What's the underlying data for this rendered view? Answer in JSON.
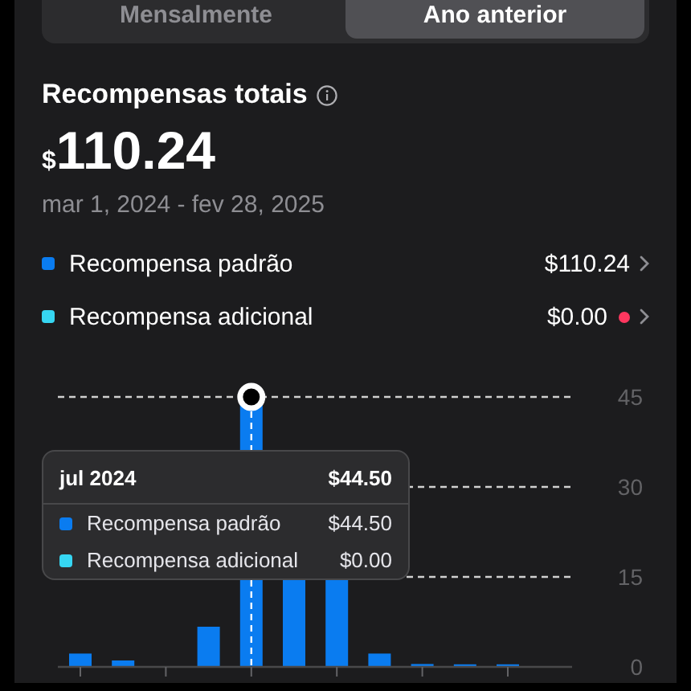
{
  "segments": [
    {
      "label": "Mensalmente",
      "selected": false
    },
    {
      "label": "Ano anterior",
      "selected": true
    }
  ],
  "summary": {
    "title": "Recompensas totais",
    "currency": "$",
    "amount": "110.24",
    "period": "mar 1, 2024 - fev 28, 2025"
  },
  "breakdown": [
    {
      "label": "Recompensa padrão",
      "value": "$110.24",
      "color": "#0a7cf0",
      "alert": false
    },
    {
      "label": "Recompensa adicional",
      "value": "$0.00",
      "color": "#36d6f2",
      "alert": true
    }
  ],
  "chart": {
    "y_labels": [
      "45",
      "30",
      "15",
      "0"
    ],
    "tooltip": {
      "period": "jul 2024",
      "total": "$44.50",
      "rows": [
        {
          "label": "Recompensa padrão",
          "value": "$44.50",
          "color": "#0a7cf0"
        },
        {
          "label": "Recompensa adicional",
          "value": "$0.00",
          "color": "#36d6f2"
        }
      ]
    }
  }
}
